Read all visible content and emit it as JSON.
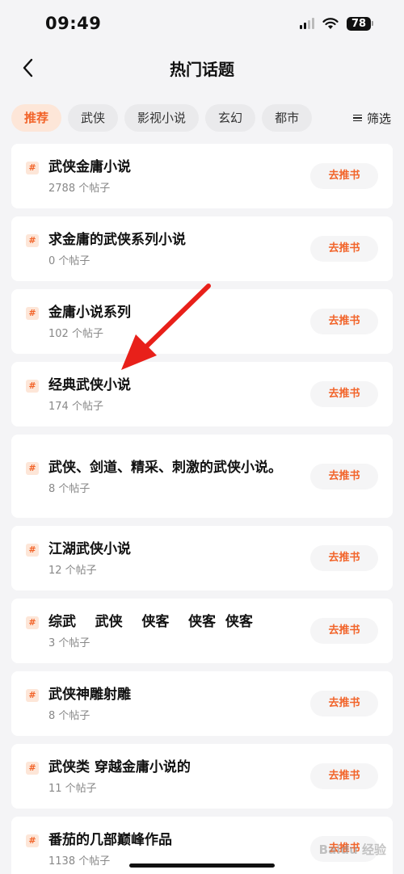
{
  "status_bar": {
    "time": "09:49",
    "battery": "78"
  },
  "header": {
    "title": "热门话题"
  },
  "tabs": [
    {
      "label": "推荐",
      "active": true
    },
    {
      "label": "武侠",
      "active": false
    },
    {
      "label": "影视小说",
      "active": false
    },
    {
      "label": "玄幻",
      "active": false
    },
    {
      "label": "都市",
      "active": false
    }
  ],
  "filter": {
    "label": "筛选"
  },
  "topics": [
    {
      "title": "武侠金庸小说",
      "count": "2788 个帖子",
      "button": "去推书"
    },
    {
      "title": "求金庸的武侠系列小说",
      "count": "0 个帖子",
      "button": "去推书"
    },
    {
      "title": "金庸小说系列",
      "count": "102 个帖子",
      "button": "去推书"
    },
    {
      "title": "经典武侠小说",
      "count": "174 个帖子",
      "button": "去推书"
    },
    {
      "title": "武侠、剑道、精采、刺激的武侠小说。",
      "count": "8 个帖子",
      "button": "去推书"
    },
    {
      "title": "江湖武侠小说",
      "count": "12 个帖子",
      "button": "去推书"
    },
    {
      "title": "综武    武侠    侠客    侠客  侠客",
      "count": "3 个帖子",
      "button": "去推书"
    },
    {
      "title": "武侠神雕射雕",
      "count": "8 个帖子",
      "button": "去推书"
    },
    {
      "title": "武侠类 穿越金庸小说的",
      "count": "11 个帖子",
      "button": "去推书"
    },
    {
      "title": "番茄的几部巅峰作品",
      "count": "1138 个帖子",
      "button": "去推书"
    }
  ],
  "watermark": "Baidu 经验",
  "colors": {
    "accent": "#f2642a",
    "accent_bg": "#fde6d8",
    "annotation_arrow": "#e8201a"
  }
}
